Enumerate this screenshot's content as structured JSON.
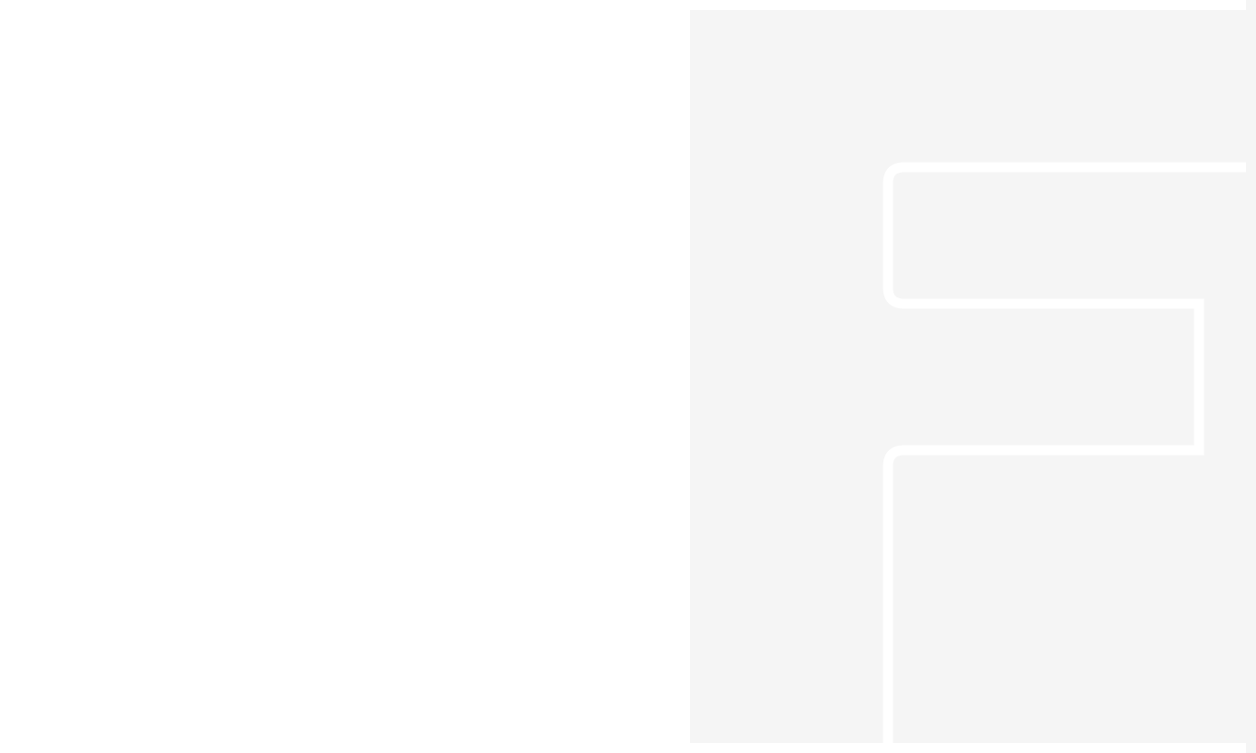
{
  "colors": {
    "background": "#ffffff",
    "panel": "#f5f5f5",
    "logo_outline": "#ffffff"
  },
  "logo": {
    "icon": "letter-f-outline-icon"
  }
}
